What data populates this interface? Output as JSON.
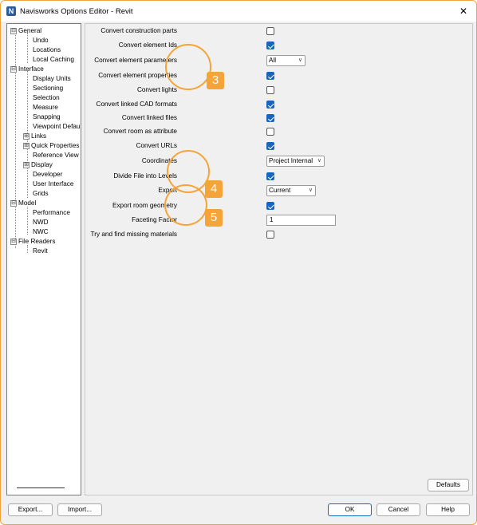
{
  "window": {
    "title": "Navisworks Options Editor - Revit",
    "app_icon_letter": "N",
    "close_glyph": "✕"
  },
  "tree": {
    "items": [
      {
        "label": "General",
        "expander": "⊟"
      },
      {
        "label": "Undo"
      },
      {
        "label": "Locations"
      },
      {
        "label": "Local Caching"
      },
      {
        "label": "Interface",
        "expander": "⊟"
      },
      {
        "label": "Display Units"
      },
      {
        "label": "Sectioning"
      },
      {
        "label": "Selection"
      },
      {
        "label": "Measure"
      },
      {
        "label": "Snapping"
      },
      {
        "label": "Viewpoint Defau"
      },
      {
        "label": "Links",
        "expander": "⊞"
      },
      {
        "label": "Quick Properties",
        "expander": "⊞"
      },
      {
        "label": "Reference View"
      },
      {
        "label": "Display",
        "expander": "⊞"
      },
      {
        "label": "Developer"
      },
      {
        "label": "User Interface"
      },
      {
        "label": "Grids"
      },
      {
        "label": "Model",
        "expander": "⊟"
      },
      {
        "label": "Performance"
      },
      {
        "label": "NWD"
      },
      {
        "label": "NWC"
      },
      {
        "label": "File Readers",
        "expander": "⊟"
      },
      {
        "label": "Revit"
      }
    ]
  },
  "options": {
    "convert_construction_parts": {
      "label": "Convert construction parts",
      "checked": false
    },
    "convert_element_ids": {
      "label": "Convert element Ids",
      "checked": true
    },
    "convert_element_parameters": {
      "label": "Convert element parameters",
      "value": "All"
    },
    "convert_element_properties": {
      "label": "Convert element properties",
      "checked": true
    },
    "convert_lights": {
      "label": "Convert lights",
      "checked": false
    },
    "convert_linked_cad": {
      "label": "Convert linked CAD formats",
      "checked": true
    },
    "convert_linked_files": {
      "label": "Convert linked files",
      "checked": true
    },
    "convert_room_attribute": {
      "label": "Convert room as attribute",
      "checked": false
    },
    "convert_urls": {
      "label": "Convert URLs",
      "checked": true
    },
    "coordinates": {
      "label": "Coordinates",
      "value": "Project Internal"
    },
    "divide_levels": {
      "label": "Divide File into Levels",
      "checked": true
    },
    "export": {
      "label": "Export",
      "value": "Current"
    },
    "export_room_geometry": {
      "label": "Export room geometry",
      "checked": true
    },
    "faceting_factor": {
      "label": "Faceting Factor",
      "value": "1"
    },
    "find_missing_materials": {
      "label": "Try and find missing materials",
      "checked": false
    }
  },
  "callouts": [
    "3",
    "4",
    "5"
  ],
  "buttons": {
    "defaults": "Defaults",
    "export": "Export...",
    "import": "Import...",
    "ok": "OK",
    "cancel": "Cancel",
    "help": "Help"
  },
  "colors": {
    "accent": "#1665c1",
    "callout": "#f5a43a",
    "window_border": "#f2a23a"
  }
}
